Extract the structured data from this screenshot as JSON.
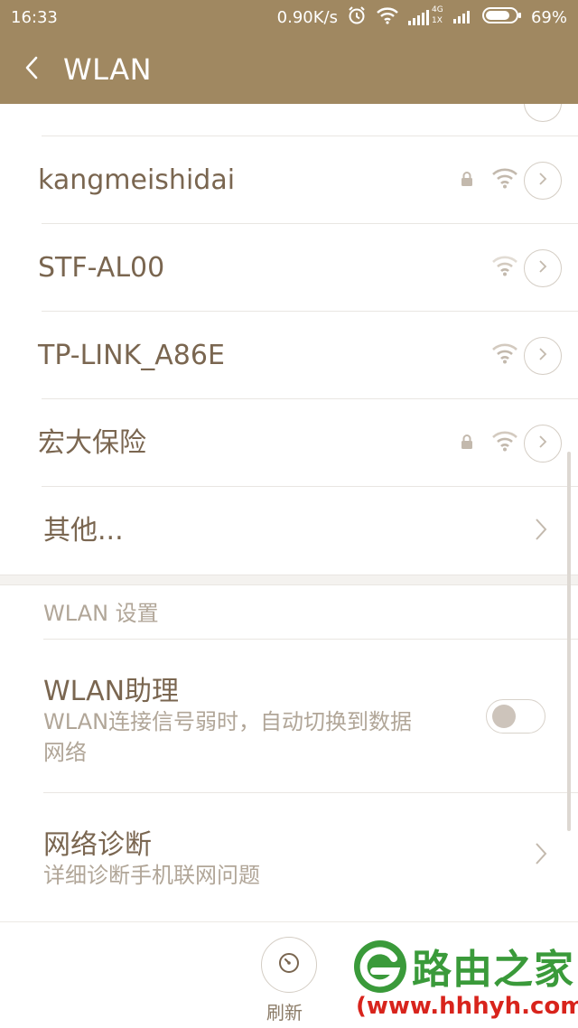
{
  "status_bar": {
    "time": "16:33",
    "speed": "0.90K/s",
    "network_top": "4G",
    "network_bottom": "1X",
    "battery": "69%"
  },
  "header": {
    "title": "WLAN"
  },
  "networks": [
    {
      "ssid": "kangmeishidai",
      "locked": true
    },
    {
      "ssid": "STF-AL00",
      "locked": false
    },
    {
      "ssid": "TP-LINK_A86E",
      "locked": false
    },
    {
      "ssid": "宏大保险",
      "locked": true
    }
  ],
  "other": {
    "label": "其他..."
  },
  "settings_section": {
    "title": "WLAN 设置"
  },
  "wlan_assistant": {
    "title": "WLAN助理",
    "desc_line1": "WLAN连接信号弱时，自动切换到数据",
    "desc_line2": "网络",
    "enabled": false
  },
  "diagnose": {
    "title": "网络诊断",
    "desc": "详细诊断手机联网问题"
  },
  "bottom": {
    "refresh_label": "刷新"
  },
  "watermark": {
    "brand": "路由之家",
    "url": "(www.hhhyh.com"
  },
  "colors": {
    "accent": "#a08861",
    "text": "#7a6650",
    "muted": "#b1a698"
  }
}
